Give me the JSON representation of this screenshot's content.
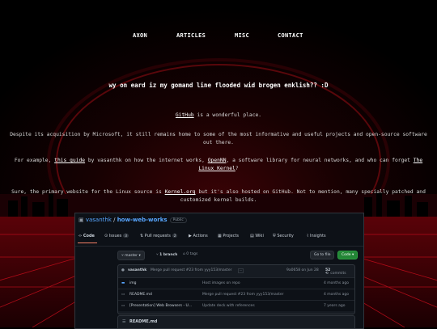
{
  "nav": {
    "items": [
      "AXON",
      "ARTICLES",
      "MISC",
      "CONTACT"
    ]
  },
  "heading": "wy on eard iz my gomand line flooded wid brogen enklish?? :D",
  "paragraphs": {
    "p1": {
      "link": "GitHub",
      "text": " is a wonderful place."
    },
    "p2": "Despite its acquisition by Microsoft, it still remains home to some of the most informative and useful projects and open-source software out there.",
    "p3": {
      "t1": "For example, ",
      "link1": "this guide",
      "t2": " by vasanthk on how the internet works, ",
      "link2": "OpenNN",
      "t3": ", a software library for neural networks, and who can forget ",
      "link3": "The Linux Kernel",
      "t4": "?"
    },
    "p4": {
      "t1": "Sure, the primary website for the Linux source is ",
      "link": "Kernel.org",
      "t2": " but it's also hosted on GitHub. Not to mention, many specially patched and customized kernel builds."
    }
  },
  "github": {
    "owner": "vasanthk",
    "separator": " / ",
    "repo": "how-web-works",
    "visibility": "Public",
    "tabs": [
      {
        "label": "Code",
        "count": ""
      },
      {
        "label": "Issues",
        "count": "3"
      },
      {
        "label": "Pull requests",
        "count": "2"
      },
      {
        "label": "Actions",
        "count": ""
      },
      {
        "label": "Projects",
        "count": ""
      },
      {
        "label": "Wiki",
        "count": ""
      },
      {
        "label": "Security",
        "count": ""
      },
      {
        "label": "Insights",
        "count": ""
      }
    ],
    "branch_button": "master",
    "branches": "1 branch",
    "tags": "0 tags",
    "goto_button": "Go to file",
    "code_button": "Code",
    "commit": {
      "author": "vasanthk",
      "message": "Merge pull request #23 from yyy153/master",
      "hash": "9a0658 on Jun 28",
      "commits_count": "52",
      "commits_label": "commits"
    },
    "files": [
      {
        "name": "img",
        "message": "Host images on repo",
        "date": "4 months ago"
      },
      {
        "name": "README.md",
        "message": "Merge pull request #23 from yyy153/master",
        "date": "4 months ago"
      },
      {
        "name": "[Presentation] Web Browsers - U...",
        "message": "Update deck with references",
        "date": "7 years ago"
      }
    ],
    "readme_label": "README.md"
  },
  "colors": {
    "background": "#000000",
    "accent_red": "#c40a14",
    "link": "#58a6ff",
    "green_button": "#238636"
  }
}
